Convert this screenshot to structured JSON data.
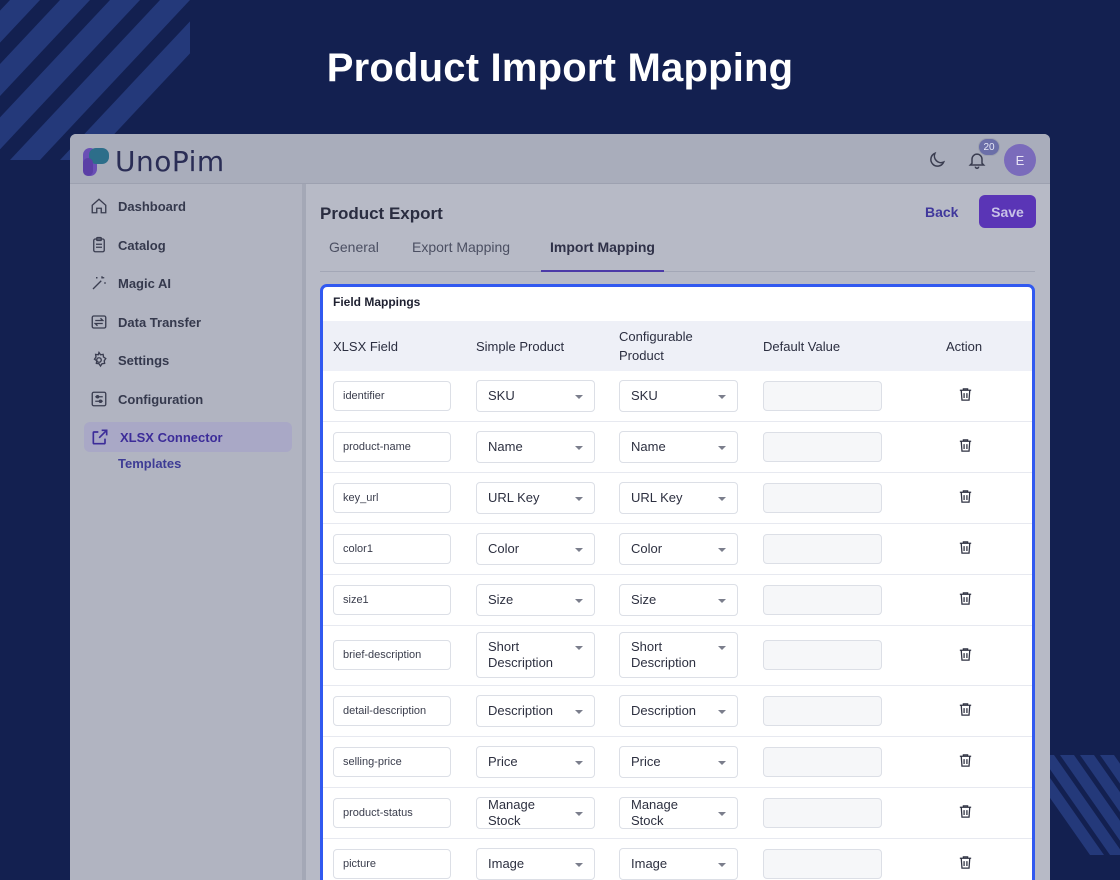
{
  "hero": {
    "title": "Product Import Mapping"
  },
  "app": {
    "logo_text": "UnoPim",
    "notification_count": "20",
    "avatar_initial": "E"
  },
  "sidebar": {
    "items": [
      {
        "label": "Dashboard",
        "icon": "home-icon"
      },
      {
        "label": "Catalog",
        "icon": "clipboard-icon"
      },
      {
        "label": "Magic AI",
        "icon": "magic-wand-icon"
      },
      {
        "label": "Data Transfer",
        "icon": "transfer-icon"
      },
      {
        "label": "Settings",
        "icon": "gear-icon"
      },
      {
        "label": "Configuration",
        "icon": "sliders-icon"
      },
      {
        "label": "XLSX Connector",
        "icon": "export-icon",
        "active": true
      }
    ],
    "sub_item": "Templates"
  },
  "page": {
    "title": "Product Export",
    "back_label": "Back",
    "save_label": "Save",
    "tabs": [
      {
        "label": "General"
      },
      {
        "label": "Export Mapping"
      },
      {
        "label": "Import Mapping",
        "active": true
      }
    ]
  },
  "mappings": {
    "title": "Field Mappings",
    "columns": {
      "xlsx": "XLSX Field",
      "simple": "Simple Product",
      "configurable": "Configurable Product",
      "default": "Default Value",
      "action": "Action"
    },
    "rows": [
      {
        "field": "identifier",
        "simple": "SKU",
        "configurable": "SKU"
      },
      {
        "field": "product-name",
        "simple": "Name",
        "configurable": "Name"
      },
      {
        "field": "key_url",
        "simple": "URL Key",
        "configurable": "URL Key"
      },
      {
        "field": "color1",
        "simple": "Color",
        "configurable": "Color"
      },
      {
        "field": "size1",
        "simple": "Size",
        "configurable": "Size"
      },
      {
        "field": "brief-description",
        "simple": "Short Description",
        "configurable": "Short Description"
      },
      {
        "field": "detail-description",
        "simple": "Description",
        "configurable": "Description"
      },
      {
        "field": "selling-price",
        "simple": "Price",
        "configurable": "Price"
      },
      {
        "field": "product-status",
        "simple": "Manage Stock",
        "configurable": "Manage Stock"
      },
      {
        "field": "picture",
        "simple": "Image",
        "configurable": "Image"
      }
    ]
  },
  "colors": {
    "accent": "#5a35b6",
    "panel_border": "#3159f0",
    "background": "#132050"
  }
}
